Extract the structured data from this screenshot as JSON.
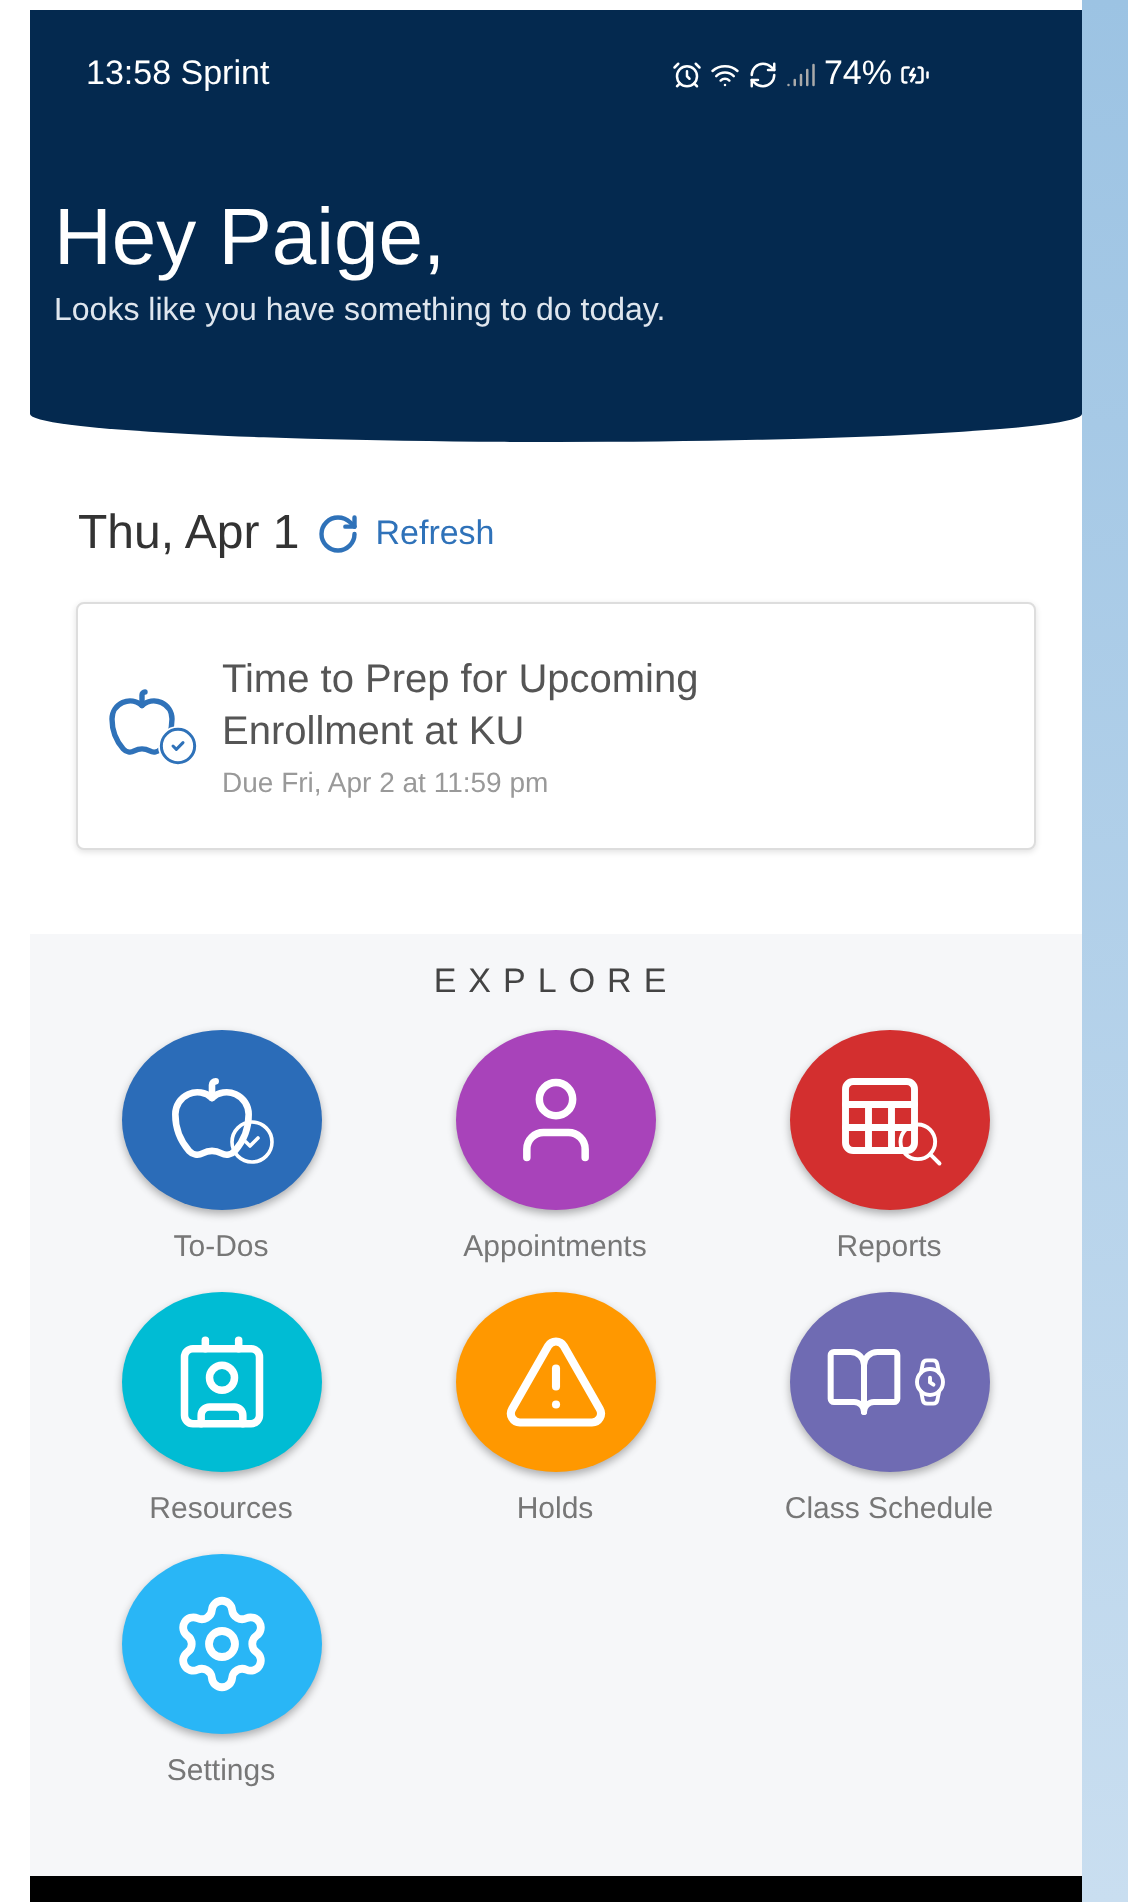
{
  "status_bar": {
    "time": "13:58 Sprint",
    "battery": "74%"
  },
  "header": {
    "greeting": "Hey Paige,",
    "subtitle": "Looks like you have something to do today."
  },
  "date_row": {
    "date": "Thu, Apr 1",
    "refresh": "Refresh"
  },
  "todo_card": {
    "title": "Time to Prep for Upcoming Enrollment at KU",
    "due": "Due Fri, Apr 2 at 11:59 pm"
  },
  "explore": {
    "heading": "EXPLORE",
    "tiles": [
      {
        "label": "To-Dos",
        "kind": "todos",
        "color": "#2b6cb8"
      },
      {
        "label": "Appointments",
        "kind": "appointments",
        "color": "#a843ba"
      },
      {
        "label": "Reports",
        "kind": "reports",
        "color": "#d32f2f"
      },
      {
        "label": "Resources",
        "kind": "resources",
        "color": "#00bcd4"
      },
      {
        "label": "Holds",
        "kind": "holds",
        "color": "#ff9800"
      },
      {
        "label": "Class Schedule",
        "kind": "schedule",
        "color": "#6f6bb3"
      },
      {
        "label": "Settings",
        "kind": "settings",
        "color": "#29b6f6"
      }
    ]
  }
}
